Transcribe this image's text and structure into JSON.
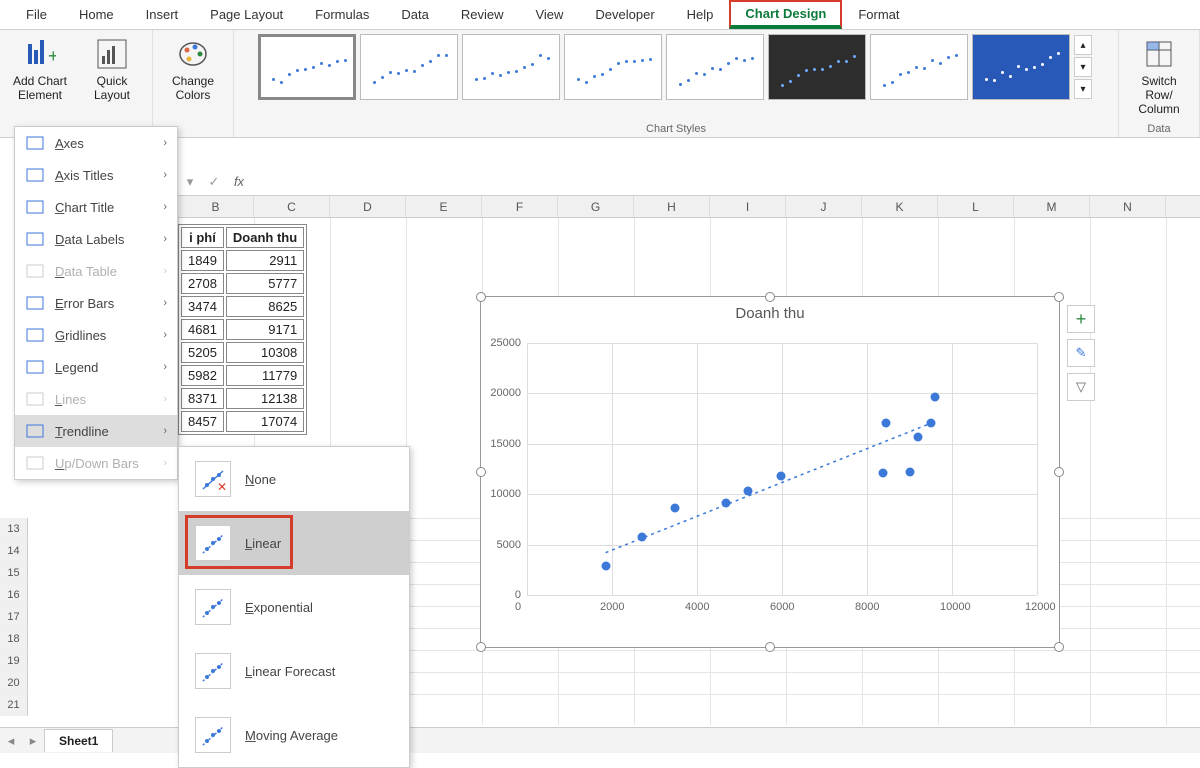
{
  "ribbon_tabs": [
    "File",
    "Home",
    "Insert",
    "Page Layout",
    "Formulas",
    "Data",
    "Review",
    "View",
    "Developer",
    "Help",
    "Chart Design",
    "Format"
  ],
  "ribbon": {
    "add_chart_element": "Add Chart\nElement",
    "quick_layout": "Quick\nLayout",
    "change_colors": "Change\nColors",
    "chart_styles_label": "Chart Styles",
    "switch_row_col": "Switch Row/\nColumn",
    "data_label": "Data"
  },
  "dropdown_items": [
    {
      "label": "Axes",
      "enabled": true
    },
    {
      "label": "Axis Titles",
      "enabled": true
    },
    {
      "label": "Chart Title",
      "enabled": true
    },
    {
      "label": "Data Labels",
      "enabled": true
    },
    {
      "label": "Data Table",
      "enabled": false
    },
    {
      "label": "Error Bars",
      "enabled": true
    },
    {
      "label": "Gridlines",
      "enabled": true
    },
    {
      "label": "Legend",
      "enabled": true
    },
    {
      "label": "Lines",
      "enabled": false
    },
    {
      "label": "Trendline",
      "enabled": true,
      "active": true
    },
    {
      "label": "Up/Down Bars",
      "enabled": false
    }
  ],
  "submenu_items": [
    {
      "label": "None"
    },
    {
      "label": "Linear",
      "selected": true,
      "highlighted": true
    },
    {
      "label": "Exponential"
    },
    {
      "label": "Linear Forecast"
    },
    {
      "label": "Moving Average"
    }
  ],
  "formula_bar": {
    "fx": "fx",
    "check": "✓",
    "cancel": "✕",
    "dropdown": "▾"
  },
  "columns": [
    "B",
    "C",
    "D",
    "E",
    "F",
    "G",
    "H",
    "I",
    "J",
    "K",
    "L",
    "M",
    "N"
  ],
  "row_numbers": [
    13,
    14,
    15,
    16,
    17,
    18,
    19,
    20,
    21
  ],
  "table": {
    "headers": [
      "i phí",
      "Doanh thu"
    ],
    "rows": [
      [
        1849,
        2911
      ],
      [
        2708,
        5777
      ],
      [
        3474,
        8625
      ],
      [
        4681,
        9171
      ],
      [
        5205,
        10308
      ],
      [
        5982,
        11779
      ],
      [
        8371,
        12138
      ],
      [
        8457,
        17074
      ]
    ]
  },
  "sheet_tab": "Sheet1",
  "chart_data": {
    "type": "scatter",
    "title": "Doanh thu",
    "xlabel": "",
    "ylabel": "",
    "xlim": [
      0,
      12000
    ],
    "ylim": [
      0,
      25000
    ],
    "x_ticks": [
      0,
      2000,
      4000,
      6000,
      8000,
      10000,
      12000
    ],
    "y_ticks": [
      0,
      5000,
      10000,
      15000,
      20000,
      25000
    ],
    "series": [
      {
        "name": "Doanh thu",
        "x": [
          1849,
          2708,
          3474,
          4681,
          5205,
          5982,
          8371,
          8457,
          9000,
          9200,
          9500,
          9600
        ],
        "y": [
          2911,
          5777,
          8625,
          9171,
          10308,
          11779,
          12138,
          17074,
          12200,
          15700,
          17100,
          19600
        ]
      }
    ],
    "trendline": {
      "type": "linear",
      "start": [
        1849,
        4200
      ],
      "end": [
        9600,
        17200
      ],
      "style": "dotted",
      "color": "#3b78d8"
    }
  }
}
